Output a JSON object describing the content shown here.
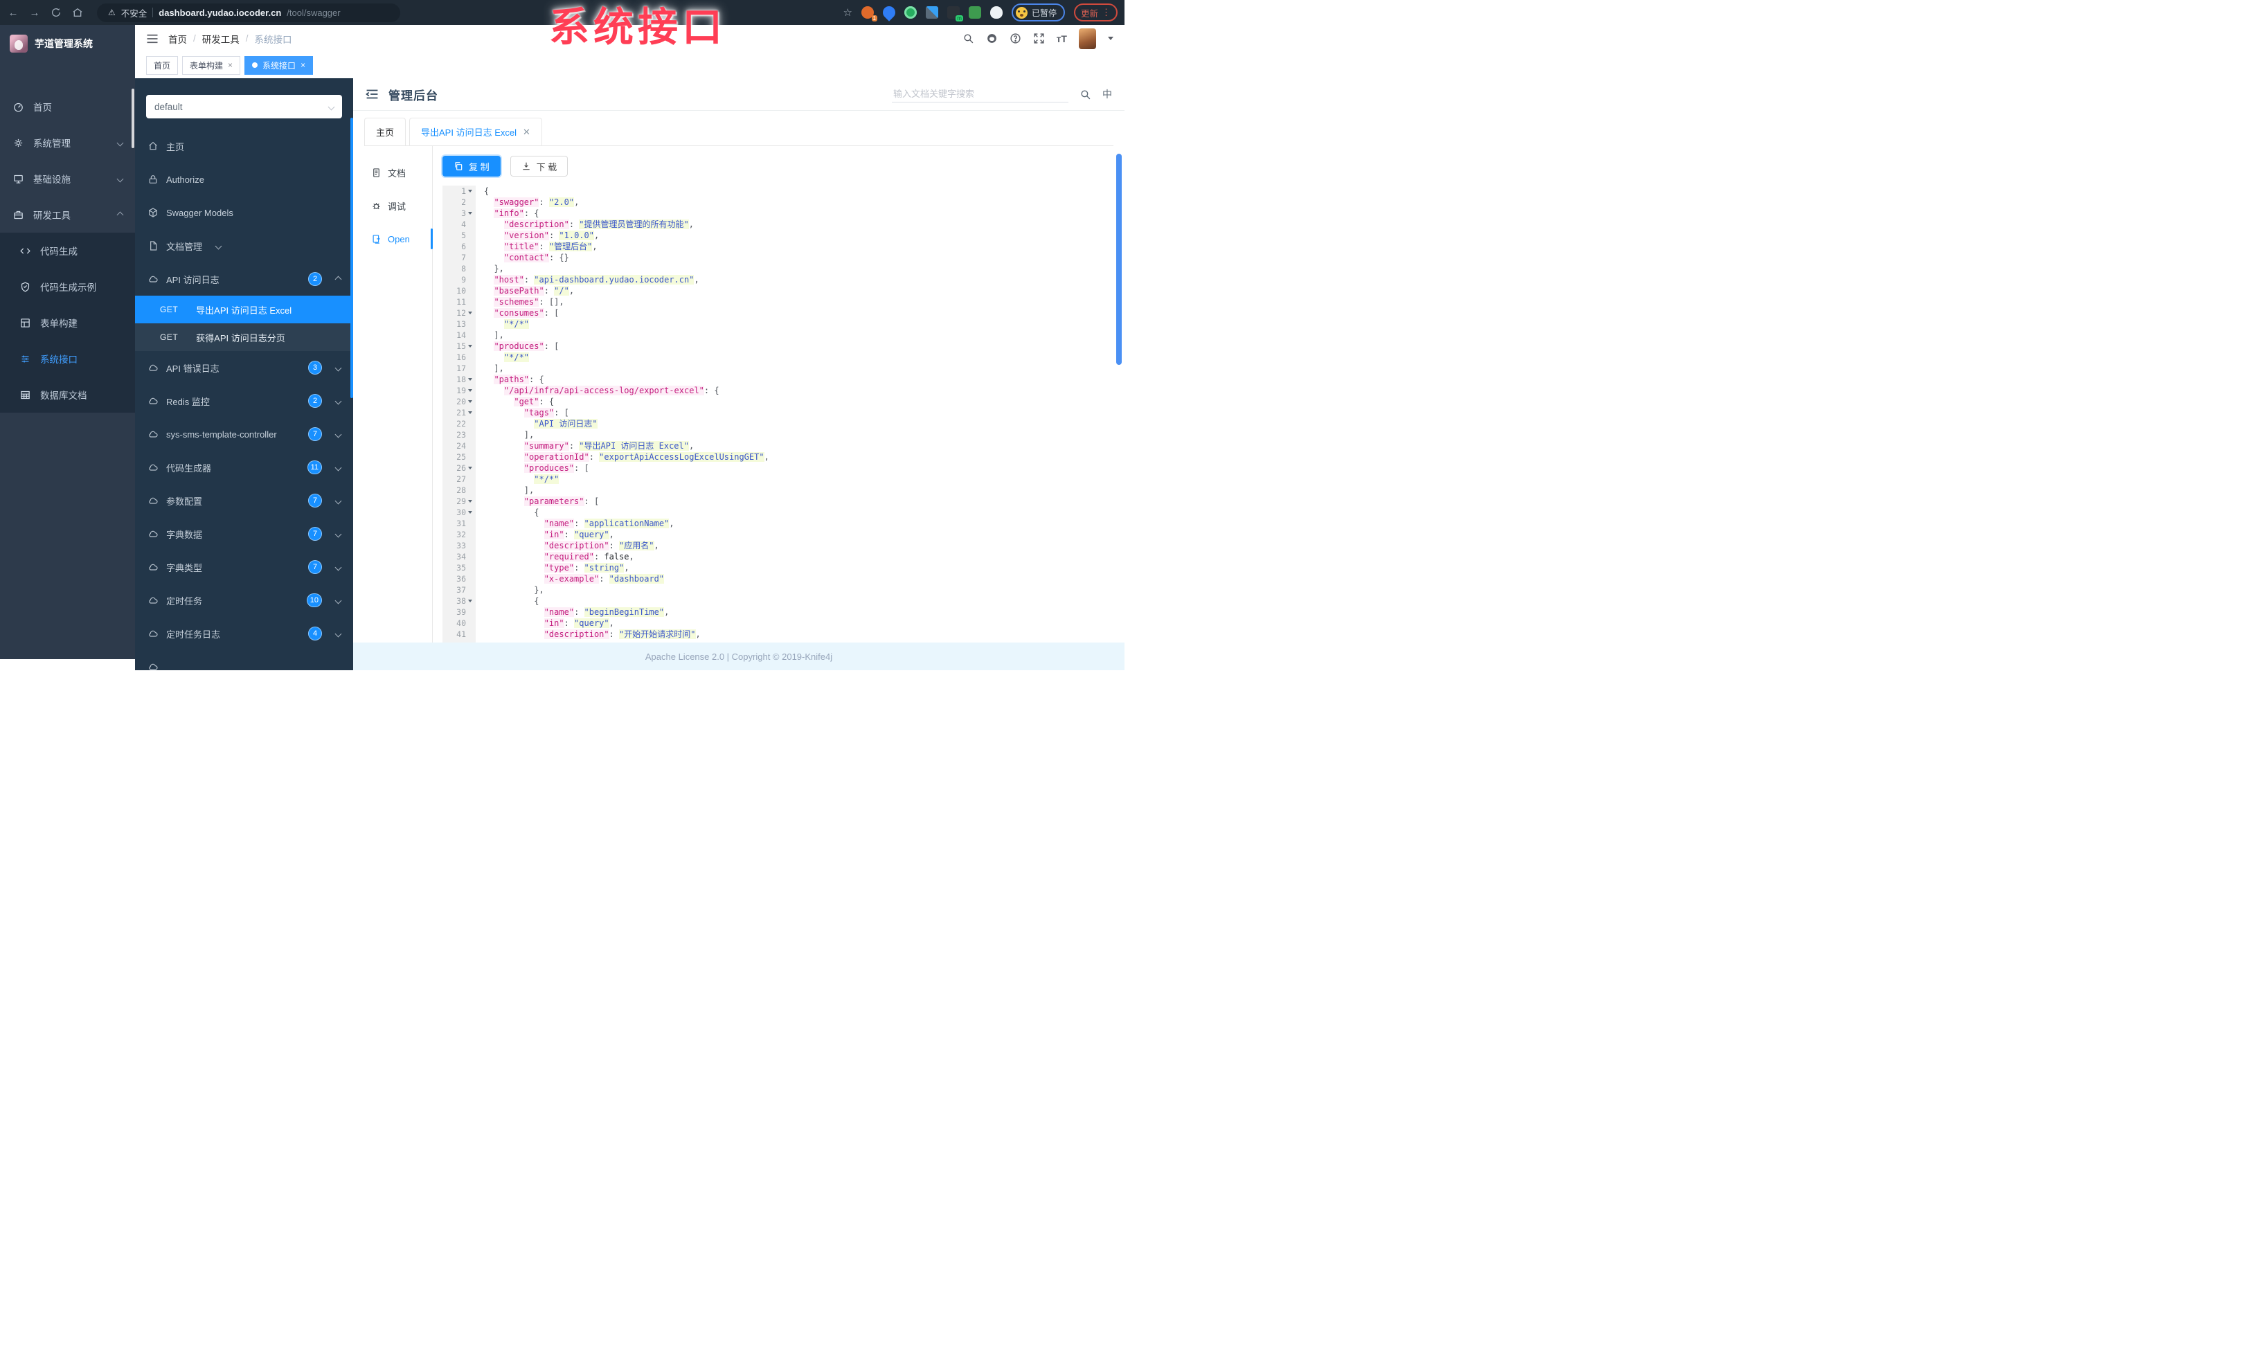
{
  "browser": {
    "security_label": "不安全",
    "url_host": "dashboard.yudao.iocoder.cn",
    "url_path": "/tool/swagger",
    "extension_badge_count": "1",
    "extension_m_badge": "m",
    "paused_badge": "已暂停",
    "update_button": "更新"
  },
  "overlay": {
    "title": "系统接口"
  },
  "app": {
    "logo_title": "芋道管理系统",
    "breadcrumb": [
      "首页",
      "研发工具",
      "系统接口"
    ],
    "tabs": [
      {
        "id": "home",
        "label": "首页",
        "closable": false,
        "active": false
      },
      {
        "id": "form-builder",
        "label": "表单构建",
        "closable": true,
        "active": false
      },
      {
        "id": "system-api",
        "label": "系统接口",
        "closable": true,
        "active": true
      }
    ],
    "sidebar_items": [
      {
        "id": "home",
        "label": "首页",
        "icon": "dashboard"
      },
      {
        "id": "system-management",
        "label": "系统管理",
        "icon": "gear",
        "chevron": "down"
      },
      {
        "id": "infrastructure",
        "label": "基础设施",
        "icon": "infra",
        "chevron": "down"
      },
      {
        "id": "dev-tools",
        "label": "研发工具",
        "icon": "tools",
        "chevron": "up"
      }
    ],
    "sidebar_sub_items": [
      {
        "id": "code-generation",
        "label": "代码生成",
        "icon": "code"
      },
      {
        "id": "code-generation-example",
        "label": "代码生成示例",
        "icon": "shield"
      },
      {
        "id": "form-builder",
        "label": "表单构建",
        "icon": "form"
      },
      {
        "id": "system-api",
        "label": "系统接口",
        "icon": "list",
        "active": true
      },
      {
        "id": "database-doc",
        "label": "数据库文档",
        "icon": "table"
      }
    ]
  },
  "swagger": {
    "group_select_value": "default",
    "menu": [
      {
        "type": "item",
        "id": "home",
        "icon": "home",
        "label": "主页"
      },
      {
        "type": "item",
        "id": "authorize",
        "icon": "lock",
        "label": "Authorize"
      },
      {
        "type": "item",
        "id": "swagger-models",
        "icon": "models",
        "label": "Swagger Models"
      },
      {
        "type": "item",
        "id": "doc-management",
        "icon": "docs",
        "label": "文档管理",
        "chevron": "down"
      },
      {
        "type": "item",
        "id": "api-access-log",
        "icon": "cloud",
        "label": "API 访问日志",
        "badge": "2",
        "chevron": "up"
      },
      {
        "type": "get",
        "id": "export-api-access-log-excel",
        "method": "GET",
        "label": "导出API 访问日志 Excel",
        "active": true
      },
      {
        "type": "get",
        "id": "get-api-access-log-page",
        "method": "GET",
        "label": "获得API 访问日志分页",
        "active": false
      },
      {
        "type": "item",
        "id": "api-error-log",
        "icon": "cloud",
        "label": "API 错误日志",
        "badge": "3",
        "chevron": "down"
      },
      {
        "type": "item",
        "id": "redis-monitor",
        "icon": "cloud",
        "label": "Redis 监控",
        "badge": "2",
        "chevron": "down"
      },
      {
        "type": "item",
        "id": "sys-sms-template-controller",
        "icon": "cloud",
        "label": "sys-sms-template-controller",
        "badge": "7",
        "chevron": "down"
      },
      {
        "type": "item",
        "id": "code-generator",
        "icon": "cloud",
        "label": "代码生成器",
        "badge": "11",
        "chevron": "down"
      },
      {
        "type": "item",
        "id": "param-config",
        "icon": "cloud",
        "label": "参数配置",
        "badge": "7",
        "chevron": "down"
      },
      {
        "type": "item",
        "id": "dict-data",
        "icon": "cloud",
        "label": "字典数据",
        "badge": "7",
        "chevron": "down"
      },
      {
        "type": "item",
        "id": "dict-type",
        "icon": "cloud",
        "label": "字典类型",
        "badge": "7",
        "chevron": "down"
      },
      {
        "type": "item",
        "id": "scheduled-task",
        "icon": "cloud",
        "label": "定时任务",
        "badge": "10",
        "chevron": "down"
      },
      {
        "type": "item",
        "id": "scheduled-task-log",
        "icon": "cloud",
        "label": "定时任务日志",
        "badge": "4",
        "chevron": "down"
      },
      {
        "type": "item",
        "id": "partial-bottom-item",
        "icon": "cloud",
        "label": "",
        "partial": true
      }
    ]
  },
  "doc": {
    "title": "管理后台",
    "search_placeholder": "输入文档关键字搜索",
    "lang_toggle": "中",
    "tabs": [
      {
        "id": "home",
        "label": "主页",
        "active": false,
        "closable": false
      },
      {
        "id": "export-api-access-log-excel",
        "label": "导出API 访问日志 Excel",
        "active": true,
        "closable": true
      }
    ],
    "rail": [
      {
        "id": "document",
        "label": "文档",
        "icon": "docfile",
        "active": false
      },
      {
        "id": "debug",
        "label": "调试",
        "icon": "bug",
        "active": false
      },
      {
        "id": "open",
        "label": "Open",
        "icon": "openfile",
        "active": true
      }
    ],
    "copy_button": "复 制",
    "download_button": "下 载",
    "footer": "Apache License 2.0 | Copyright © 2019-Knife4j"
  },
  "editor": {
    "fold_lines": [
      1,
      3,
      12,
      15,
      18,
      19,
      20,
      21,
      26,
      29,
      30,
      38
    ],
    "lines": [
      {
        "n": 1,
        "seg": [
          [
            "p",
            "{"
          ]
        ]
      },
      {
        "n": 2,
        "seg": [
          [
            "p",
            "  "
          ],
          [
            "k",
            "\"swagger\""
          ],
          [
            "p",
            ": "
          ],
          [
            "s",
            "\"2.0\""
          ],
          [
            "p",
            ","
          ]
        ]
      },
      {
        "n": 3,
        "seg": [
          [
            "p",
            "  "
          ],
          [
            "k",
            "\"info\""
          ],
          [
            "p",
            ": {"
          ]
        ]
      },
      {
        "n": 4,
        "seg": [
          [
            "p",
            "    "
          ],
          [
            "k",
            "\"description\""
          ],
          [
            "p",
            ": "
          ],
          [
            "s",
            "\"提供管理员管理的所有功能\""
          ],
          [
            "p",
            ","
          ]
        ]
      },
      {
        "n": 5,
        "seg": [
          [
            "p",
            "    "
          ],
          [
            "k",
            "\"version\""
          ],
          [
            "p",
            ": "
          ],
          [
            "s",
            "\"1.0.0\""
          ],
          [
            "p",
            ","
          ]
        ]
      },
      {
        "n": 6,
        "seg": [
          [
            "p",
            "    "
          ],
          [
            "k",
            "\"title\""
          ],
          [
            "p",
            ": "
          ],
          [
            "s",
            "\"管理后台\""
          ],
          [
            "p",
            ","
          ]
        ]
      },
      {
        "n": 7,
        "seg": [
          [
            "p",
            "    "
          ],
          [
            "k",
            "\"contact\""
          ],
          [
            "p",
            ": {}"
          ]
        ]
      },
      {
        "n": 8,
        "seg": [
          [
            "p",
            "  },"
          ]
        ]
      },
      {
        "n": 9,
        "seg": [
          [
            "p",
            "  "
          ],
          [
            "k",
            "\"host\""
          ],
          [
            "p",
            ": "
          ],
          [
            "s",
            "\"api-dashboard.yudao.iocoder.cn\""
          ],
          [
            "p",
            ","
          ]
        ]
      },
      {
        "n": 10,
        "seg": [
          [
            "p",
            "  "
          ],
          [
            "k",
            "\"basePath\""
          ],
          [
            "p",
            ": "
          ],
          [
            "s",
            "\"/\""
          ],
          [
            "p",
            ","
          ]
        ]
      },
      {
        "n": 11,
        "seg": [
          [
            "p",
            "  "
          ],
          [
            "k",
            "\"schemes\""
          ],
          [
            "p",
            ": [],"
          ]
        ]
      },
      {
        "n": 12,
        "seg": [
          [
            "p",
            "  "
          ],
          [
            "k",
            "\"consumes\""
          ],
          [
            "p",
            ": ["
          ]
        ]
      },
      {
        "n": 13,
        "seg": [
          [
            "p",
            "    "
          ],
          [
            "s",
            "\"*/*\""
          ]
        ]
      },
      {
        "n": 14,
        "seg": [
          [
            "p",
            "  ],"
          ]
        ]
      },
      {
        "n": 15,
        "seg": [
          [
            "p",
            "  "
          ],
          [
            "k",
            "\"produces\""
          ],
          [
            "p",
            ": ["
          ]
        ]
      },
      {
        "n": 16,
        "seg": [
          [
            "p",
            "    "
          ],
          [
            "s",
            "\"*/*\""
          ]
        ]
      },
      {
        "n": 17,
        "seg": [
          [
            "p",
            "  ],"
          ]
        ]
      },
      {
        "n": 18,
        "seg": [
          [
            "p",
            "  "
          ],
          [
            "k",
            "\"paths\""
          ],
          [
            "p",
            ": {"
          ]
        ]
      },
      {
        "n": 19,
        "seg": [
          [
            "p",
            "    "
          ],
          [
            "k",
            "\"/api/infra/api-access-log/export-excel\""
          ],
          [
            "p",
            ": {"
          ]
        ]
      },
      {
        "n": 20,
        "seg": [
          [
            "p",
            "      "
          ],
          [
            "k",
            "\"get\""
          ],
          [
            "p",
            ": {"
          ]
        ]
      },
      {
        "n": 21,
        "seg": [
          [
            "p",
            "        "
          ],
          [
            "k",
            "\"tags\""
          ],
          [
            "p",
            ": ["
          ]
        ]
      },
      {
        "n": 22,
        "seg": [
          [
            "p",
            "          "
          ],
          [
            "s",
            "\"API 访问日志\""
          ]
        ]
      },
      {
        "n": 23,
        "seg": [
          [
            "p",
            "        ],"
          ]
        ]
      },
      {
        "n": 24,
        "seg": [
          [
            "p",
            "        "
          ],
          [
            "k",
            "\"summary\""
          ],
          [
            "p",
            ": "
          ],
          [
            "s",
            "\"导出API 访问日志 Excel\""
          ],
          [
            "p",
            ","
          ]
        ]
      },
      {
        "n": 25,
        "seg": [
          [
            "p",
            "        "
          ],
          [
            "k",
            "\"operationId\""
          ],
          [
            "p",
            ": "
          ],
          [
            "s",
            "\"exportApiAccessLogExcelUsingGET\""
          ],
          [
            "p",
            ","
          ]
        ]
      },
      {
        "n": 26,
        "seg": [
          [
            "p",
            "        "
          ],
          [
            "k",
            "\"produces\""
          ],
          [
            "p",
            ": ["
          ]
        ]
      },
      {
        "n": 27,
        "seg": [
          [
            "p",
            "          "
          ],
          [
            "s",
            "\"*/*\""
          ]
        ]
      },
      {
        "n": 28,
        "seg": [
          [
            "p",
            "        ],"
          ]
        ]
      },
      {
        "n": 29,
        "seg": [
          [
            "p",
            "        "
          ],
          [
            "k",
            "\"parameters\""
          ],
          [
            "p",
            ": ["
          ]
        ]
      },
      {
        "n": 30,
        "seg": [
          [
            "p",
            "          {"
          ]
        ]
      },
      {
        "n": 31,
        "seg": [
          [
            "p",
            "            "
          ],
          [
            "k",
            "\"name\""
          ],
          [
            "p",
            ": "
          ],
          [
            "s",
            "\"applicationName\""
          ],
          [
            "p",
            ","
          ]
        ]
      },
      {
        "n": 32,
        "seg": [
          [
            "p",
            "            "
          ],
          [
            "k",
            "\"in\""
          ],
          [
            "p",
            ": "
          ],
          [
            "s",
            "\"query\""
          ],
          [
            "p",
            ","
          ]
        ]
      },
      {
        "n": 33,
        "seg": [
          [
            "p",
            "            "
          ],
          [
            "k",
            "\"description\""
          ],
          [
            "p",
            ": "
          ],
          [
            "s",
            "\"应用名\""
          ],
          [
            "p",
            ","
          ]
        ]
      },
      {
        "n": 34,
        "seg": [
          [
            "p",
            "            "
          ],
          [
            "k",
            "\"required\""
          ],
          [
            "p",
            ": "
          ],
          [
            "b",
            "false"
          ],
          [
            "p",
            ","
          ]
        ]
      },
      {
        "n": 35,
        "seg": [
          [
            "p",
            "            "
          ],
          [
            "k",
            "\"type\""
          ],
          [
            "p",
            ": "
          ],
          [
            "s",
            "\"string\""
          ],
          [
            "p",
            ","
          ]
        ]
      },
      {
        "n": 36,
        "seg": [
          [
            "p",
            "            "
          ],
          [
            "k",
            "\"x-example\""
          ],
          [
            "p",
            ": "
          ],
          [
            "s",
            "\"dashboard\""
          ]
        ]
      },
      {
        "n": 37,
        "seg": [
          [
            "p",
            "          },"
          ]
        ]
      },
      {
        "n": 38,
        "seg": [
          [
            "p",
            "          {"
          ]
        ]
      },
      {
        "n": 39,
        "seg": [
          [
            "p",
            "            "
          ],
          [
            "k",
            "\"name\""
          ],
          [
            "p",
            ": "
          ],
          [
            "s",
            "\"beginBeginTime\""
          ],
          [
            "p",
            ","
          ]
        ]
      },
      {
        "n": 40,
        "seg": [
          [
            "p",
            "            "
          ],
          [
            "k",
            "\"in\""
          ],
          [
            "p",
            ": "
          ],
          [
            "s",
            "\"query\""
          ],
          [
            "p",
            ","
          ]
        ]
      },
      {
        "n": 41,
        "seg": [
          [
            "p",
            "            "
          ],
          [
            "k",
            "\"description\""
          ],
          [
            "p",
            ": "
          ],
          [
            "s",
            "\"开始开始请求时间\""
          ],
          [
            "p",
            ","
          ]
        ]
      }
    ]
  }
}
